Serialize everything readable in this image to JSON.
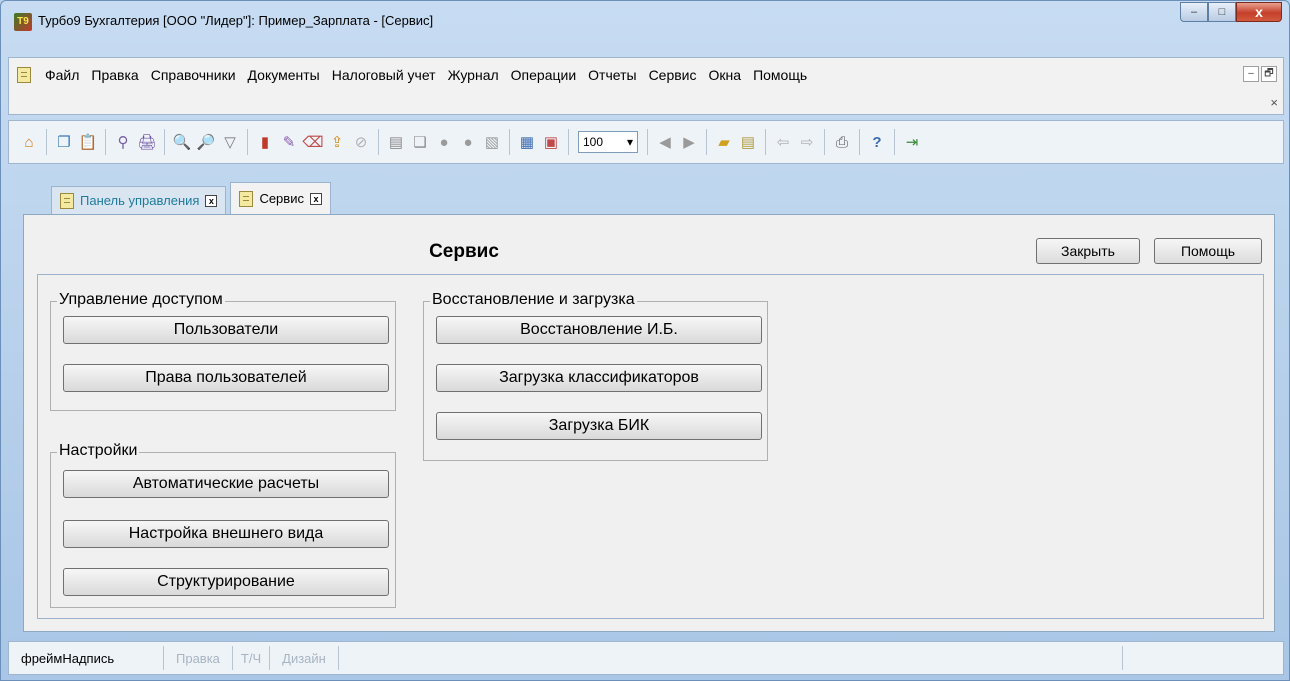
{
  "window": {
    "title": "Турбо9 Бухгалтерия [ООО \"Лидер\"]: Пример_Зарплата - [Сервис]",
    "app_icon_text": "Т9",
    "controls": {
      "minimize": "–",
      "maximize": "□",
      "close": "x"
    }
  },
  "menu": {
    "items": [
      "Файл",
      "Правка",
      "Справочники",
      "Документы",
      "Налоговый учет",
      "Журнал",
      "Операции",
      "Отчеты",
      "Сервис",
      "Окна",
      "Помощь"
    ],
    "mdi_minimize": "–",
    "mdi_restore": "🗗",
    "mdi_close": "×"
  },
  "toolbar": {
    "zoom_value": "100",
    "icons": {
      "home": "⌂",
      "copy": "❐",
      "paste": "📋",
      "find_replace": "⚲",
      "print": "🖨",
      "search": "🔍",
      "search_next": "🔎",
      "filter": "▽",
      "chart": "▮",
      "pencil": "✎",
      "eraser": "⌫",
      "export": "⇪",
      "block": "⊘",
      "doc_add": "▤",
      "doc_copy": "❏",
      "confirm": "●",
      "cancel": "●",
      "doc_x": "▧",
      "calculator": "▦",
      "calendar": "▣",
      "nav_prev": "◀",
      "nav_next": "▶",
      "folder": "▰",
      "note": "▤",
      "back": "⇦",
      "forward": "⇨",
      "print2": "⎙",
      "help": "?",
      "exit": "⇥"
    }
  },
  "tabs": [
    {
      "label": "Панель управления",
      "close": "x",
      "active": false
    },
    {
      "label": "Сервис",
      "close": "x",
      "active": true
    }
  ],
  "page": {
    "title": "Сервис",
    "close_button": "Закрыть",
    "help_button": "Помощь"
  },
  "groups": {
    "access": {
      "title": "Управление доступом",
      "buttons": [
        "Пользователи",
        "Права пользователей"
      ]
    },
    "settings": {
      "title": "Настройки",
      "buttons": [
        "Автоматические расчеты",
        "Настройка внешнего вида",
        "Структурирование"
      ]
    },
    "restore": {
      "title": "Восстановление и загрузка",
      "buttons": [
        "Восстановление И.Б.",
        "Загрузка классификаторов",
        "Загрузка БИК"
      ]
    }
  },
  "statusbar": {
    "frame_label": "фреймНадпись",
    "edit": "Правка",
    "tch": "Т/Ч",
    "design": "Дизайн"
  }
}
